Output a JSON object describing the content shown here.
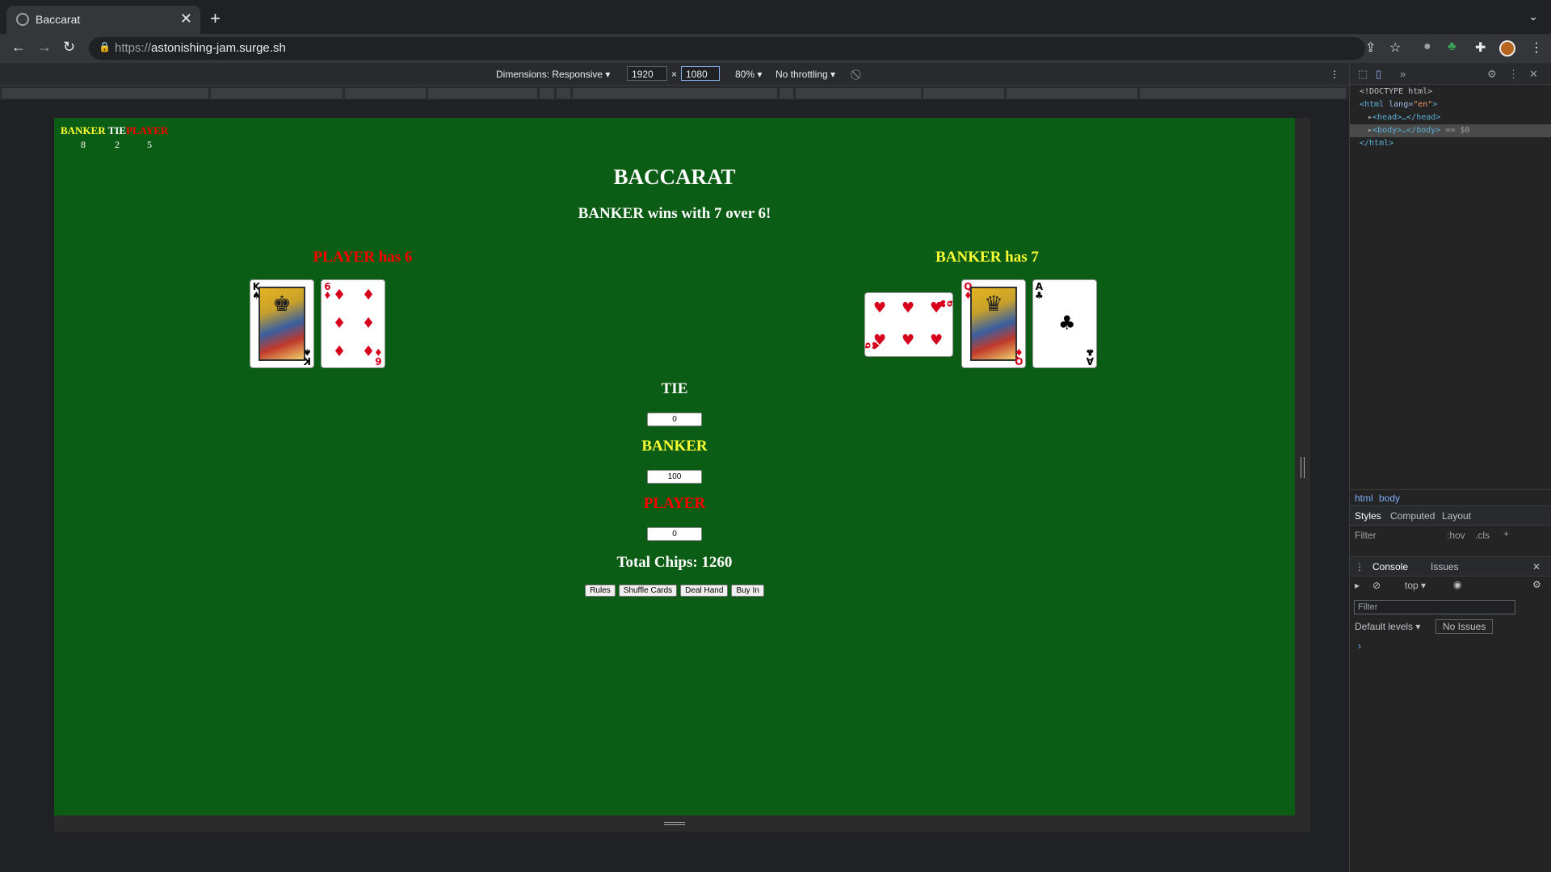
{
  "browser": {
    "tab_title": "Baccarat",
    "url_scheme": "https://",
    "url_host": "astonishing-jam.surge.sh",
    "new_tab": "+",
    "tab_close": "✕"
  },
  "devicebar": {
    "dimensions_label": "Dimensions: Responsive",
    "width": "1920",
    "times": "×",
    "height": "1080",
    "zoom": "80%",
    "throttling": "No throttling"
  },
  "scoreboard": {
    "banker_label": "BANKER",
    "tie_label": "TIE",
    "player_label": "PLAYER",
    "banker_wins": "8",
    "ties": "2",
    "player_wins": "5"
  },
  "game": {
    "title": "BACCARAT",
    "result": "BANKER wins with 7 over 6!",
    "player_hand_label": "PLAYER has 6",
    "banker_hand_label": "BANKER has 7",
    "player_cards": [
      {
        "rank": "K",
        "suit": "♠",
        "color": "#000000"
      },
      {
        "rank": "6",
        "suit": "♦",
        "color": "#d6001c"
      }
    ],
    "banker_cards": [
      {
        "rank": "6",
        "suit": "♥",
        "color": "#d6001c"
      },
      {
        "rank": "Q",
        "suit": "♦",
        "color": "#d6001c"
      },
      {
        "rank": "A",
        "suit": "♣",
        "color": "#000000"
      }
    ],
    "tie_label": "TIE",
    "tie_bet": "0",
    "banker_label": "BANKER",
    "banker_bet": "100",
    "player_label": "PLAYER",
    "player_bet": "0",
    "total_chips": "Total Chips: 1260",
    "buttons": {
      "rules": "Rules",
      "shuffle": "Shuffle Cards",
      "deal": "Deal Hand",
      "buy_in": "Buy In"
    }
  },
  "colors": {
    "table_green": "#0b5c14",
    "banker_yellow": "#ffff33",
    "player_red": "#ff0000"
  },
  "devtools": {
    "dom": {
      "doctype": "<!DOCTYPE html>",
      "html_open_tag": "<html",
      "html_attr_name": " lang=",
      "html_attr_value": "\"en\"",
      "html_open_close": ">",
      "head": "<head>…</head>",
      "body": "<body>…</body>",
      "body_marker": " == $0",
      "html_close": "</html>"
    },
    "crumbs": [
      "html",
      "body"
    ],
    "style_tabs": [
      "Styles",
      "Computed",
      "Layout"
    ],
    "filter": "Filter",
    "hov": ":hov",
    "cls": ".cls",
    "console_tabs": [
      "Console",
      "Issues"
    ],
    "context": "top",
    "console_filter": "Filter",
    "levels": "Default levels",
    "issues": "No Issues",
    "prompt": "›"
  }
}
